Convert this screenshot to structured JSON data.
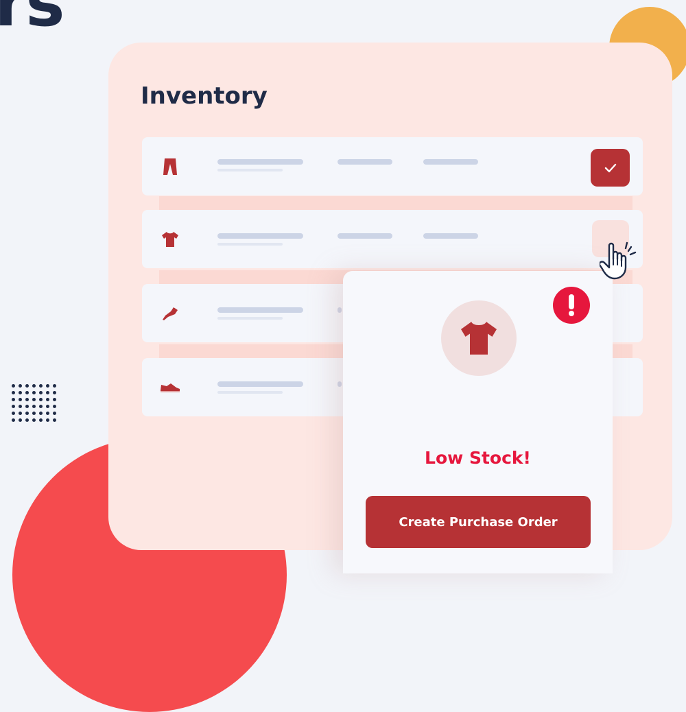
{
  "heading_fragment": "rs",
  "inventory": {
    "title": "Inventory",
    "rows": [
      {
        "item": "trousers-icon",
        "status": "checked"
      },
      {
        "item": "tshirt-icon",
        "status": "hover"
      },
      {
        "item": "heel-shoe-icon",
        "status": "none"
      },
      {
        "item": "sneaker-icon",
        "status": "none"
      }
    ]
  },
  "popup": {
    "product_icon": "tshirt-icon",
    "alert_icon": "exclamation-icon",
    "message": "Low Stock!",
    "button_label": "Create Purchase Order"
  },
  "colors": {
    "brand_red": "#b63235",
    "alert_red": "#e6173d",
    "accent_orange": "#f2b04c",
    "navy": "#1f2b47",
    "panel_pink": "#fde7e3"
  }
}
